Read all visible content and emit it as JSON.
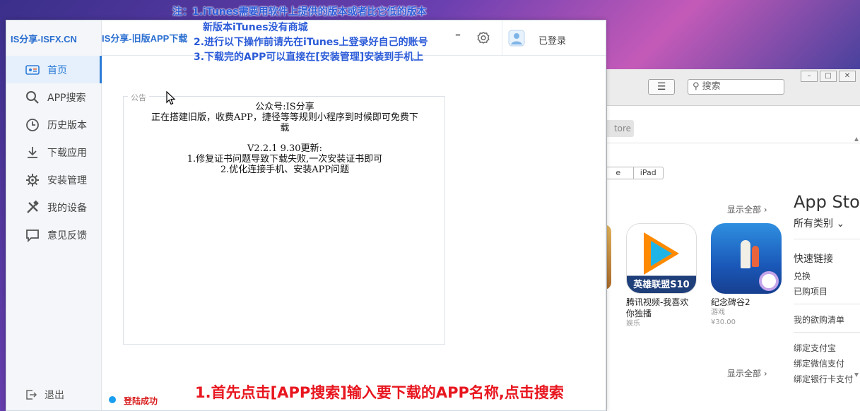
{
  "annotations": {
    "line1": "注：1.iTunes需要用软件上提供的版本或者比它低的版本",
    "line2": "新版本iTunes没有商城",
    "line3": "2.进行以下操作前请先在iTunes上登录好自己的账号",
    "line4": "3.下载完的APP可以直接在[安装管理]安装到手机上",
    "bottom": "1.首先点击[APP搜索]输入要下载的APP名称,点击搜索"
  },
  "app": {
    "brand": "IS分享-ISFX.CN",
    "title": "IS分享-旧版APP下载",
    "minimize_label": "–",
    "user_label": "已登录",
    "nav": [
      {
        "label": "首页",
        "icon": "home-icon",
        "active": true
      },
      {
        "label": "APP搜索",
        "icon": "search-icon",
        "active": false
      },
      {
        "label": "历史版本",
        "icon": "clock-icon",
        "active": false
      },
      {
        "label": "下载应用",
        "icon": "download-icon",
        "active": false
      },
      {
        "label": "安装管理",
        "icon": "install-gear-icon",
        "active": false
      },
      {
        "label": "我的设备",
        "icon": "tools-icon",
        "active": false
      },
      {
        "label": "意见反馈",
        "icon": "feedback-icon",
        "active": false
      }
    ],
    "logout_label": "退出",
    "notice": {
      "legend": "公告",
      "l1": "公众号:IS分享",
      "l2": "正在搭建旧版，收费APP，捷径等等规则小程序到时候即可免费下",
      "l3": "载",
      "l4": "V2.2.1  9.30更新:",
      "l5": "1.修复证书问题导致下载失败,一次安装证书即可",
      "l6": "2.优化连接手机、安装APP问题"
    },
    "status_text": "登陆成功"
  },
  "itunes": {
    "search_placeholder": "搜索",
    "store_tab": "tore",
    "segment": [
      "e",
      "iPad"
    ],
    "show_all_1": "显示全部 ›",
    "show_all_2": "显示全部 ›",
    "apps": [
      {
        "name": "腾讯视频-我喜欢你独播",
        "sub": "娱乐",
        "icon_band": "英雄联盟S10"
      },
      {
        "name": "纪念碑谷2",
        "sub": "游戏",
        "price": "¥30.00"
      }
    ],
    "side_title": "App Sto",
    "category": "所有类别 ⌄",
    "quick_links": "快速链接",
    "redeem": "兑换",
    "purchased": "已购项目",
    "wishlist": "我的欲购清单",
    "alipay": "绑定支付宝",
    "wechat": "绑定微信支付",
    "more": "绑定银行卡支付"
  },
  "colors": {
    "accent": "#2b7bd6",
    "notice_red": "#e8161f",
    "annotation_blue": "#2b5bd8"
  }
}
